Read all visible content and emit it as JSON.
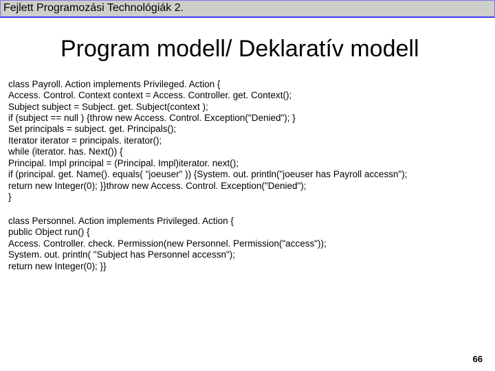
{
  "header": {
    "title": "Fejlett Programozási Technológiák 2."
  },
  "main": {
    "heading": "Program modell/ Deklaratív modell",
    "code1": "class Payroll. Action implements Privileged. Action {\nAccess. Control. Context context = Access. Controller. get. Context();\nSubject subject = Subject. get. Subject(context );\nif (subject == null ) {throw new Access. Control. Exception(\"Denied\"); }\nSet principals = subject. get. Principals();\nIterator iterator = principals. iterator();\nwhile (iterator. has. Next()) {\nPrincipal. Impl principal = (Principal. Impl)iterator. next();\nif (principal. get. Name(). equals( \"joeuser\" )) {System. out. println(\"joeuser has Payroll accessn\");\nreturn new Integer(0); }}throw new Access. Control. Exception(\"Denied\");\n}",
    "code2": "class Personnel. Action implements Privileged. Action {\npublic Object run() {\nAccess. Controller. check. Permission(new Personnel. Permission(\"access\"));\nSystem. out. println( \"Subject has Personnel accessn\");\nreturn new Integer(0); }}"
  },
  "footer": {
    "page": "66"
  }
}
